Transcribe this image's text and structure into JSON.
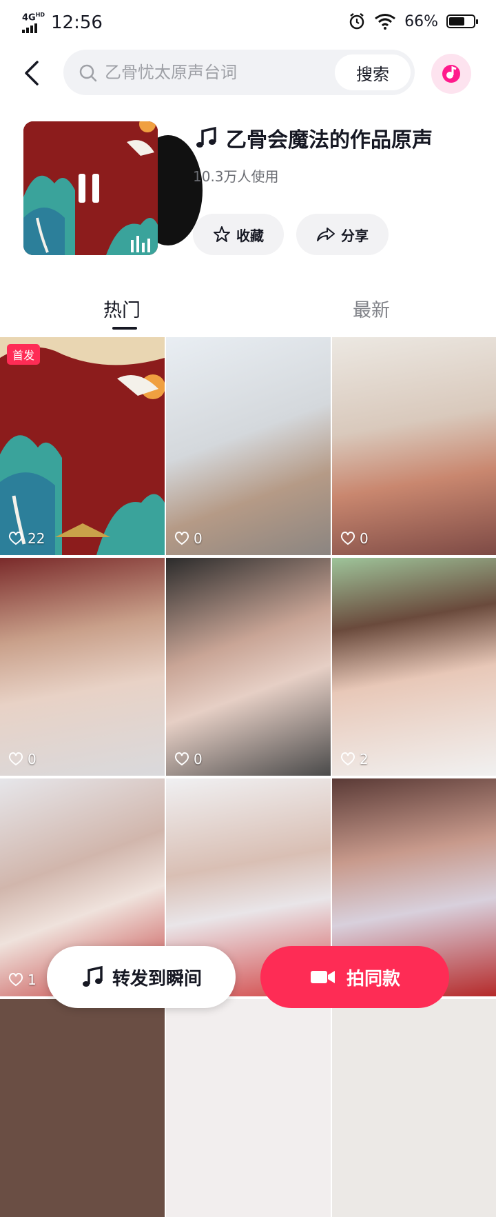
{
  "status_bar": {
    "network": "4G",
    "network_sub": "HD",
    "time": "12:56",
    "battery": "66%",
    "battery_level": 0.66
  },
  "search": {
    "placeholder": "乙骨忧太原声台词",
    "button_label": "搜索"
  },
  "music": {
    "title": "乙骨会魔法的作品原声",
    "usage": "10.3万人使用",
    "favorite_label": "收藏",
    "share_label": "分享"
  },
  "tabs": [
    {
      "label": "热门",
      "active": true
    },
    {
      "label": "最新",
      "active": false
    }
  ],
  "videos": [
    {
      "likes": "22",
      "badge": "首发"
    },
    {
      "likes": "0"
    },
    {
      "likes": "0"
    },
    {
      "likes": "0"
    },
    {
      "likes": "0"
    },
    {
      "likes": "2"
    },
    {
      "likes": "1"
    },
    {
      "likes": ""
    },
    {
      "likes": ""
    }
  ],
  "actions": {
    "share_to_moment": "转发到瞬间",
    "shoot_same": "拍同款"
  },
  "colors": {
    "accent": "#fe2c55",
    "cover_red": "#8c1c1c",
    "text": "#161823",
    "muted": "#818389"
  },
  "icons": [
    "back-icon",
    "search-icon",
    "music-app-icon",
    "pause-icon",
    "music-note-icon",
    "star-icon",
    "share-icon",
    "heart-icon",
    "camera-icon"
  ]
}
